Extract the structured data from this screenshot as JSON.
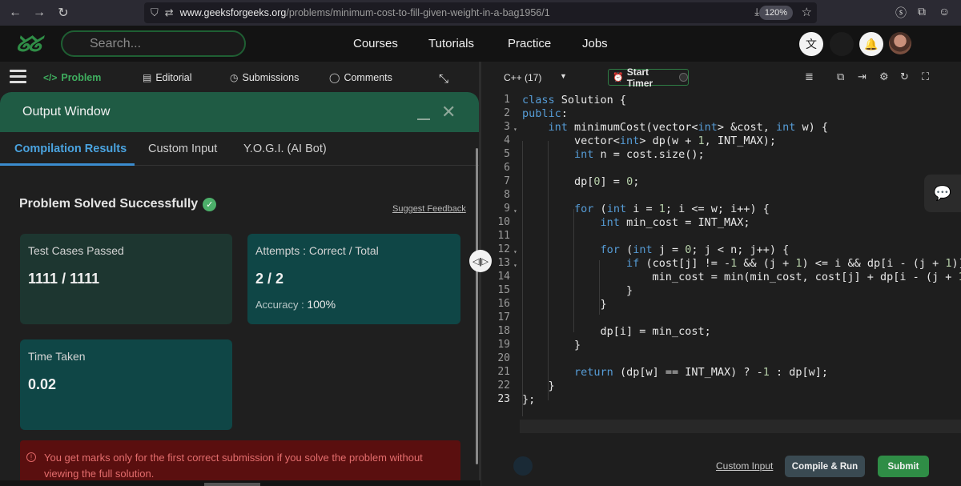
{
  "browser": {
    "url_domain": "www.geeksforgeeks.org",
    "url_path": "/problems/minimum-cost-to-fill-given-weight-in-a-bag1956/1",
    "zoom": "120%"
  },
  "header": {
    "logo": "ᘜᘜ",
    "search_placeholder": "Search...",
    "nav": [
      "Courses",
      "Tutorials",
      "Practice",
      "Jobs"
    ]
  },
  "problem_tabs": {
    "problem": "Problem",
    "editorial": "Editorial",
    "submissions": "Submissions",
    "comments": "Comments"
  },
  "output_window": {
    "title": "Output Window",
    "tabs": [
      "Compilation Results",
      "Custom Input",
      "Y.O.G.I. (AI Bot)"
    ],
    "result_title": "Problem Solved Successfully",
    "suggest_feedback": "Suggest Feedback",
    "tests_label": "Test Cases Passed",
    "tests_value": "1111 / 1111",
    "attempts_label": "Attempts : Correct / Total",
    "attempts_value": "2 / 2",
    "accuracy_label": "Accuracy :",
    "accuracy_value": "100%",
    "time_label": "Time Taken",
    "time_value": "0.02",
    "warning": "You get marks only for the first correct submission if you solve the problem without viewing the full solution."
  },
  "editor": {
    "language": "C++ (17)",
    "timer_label": "Start Timer",
    "line_numbers": [
      "1",
      "2",
      "3",
      "4",
      "5",
      "6",
      "7",
      "8",
      "9",
      "10",
      "11",
      "12",
      "13",
      "14",
      "15",
      "16",
      "17",
      "18",
      "19",
      "20",
      "21",
      "22",
      "23"
    ],
    "custom_input": "Custom Input",
    "compile_run": "Compile & Run",
    "submit": "Submit"
  },
  "colors": {
    "brand_green": "#2f8d46",
    "accent_blue": "#4aa3df",
    "output_header": "#1f5b44",
    "warning_bg": "#5a0f0f"
  }
}
